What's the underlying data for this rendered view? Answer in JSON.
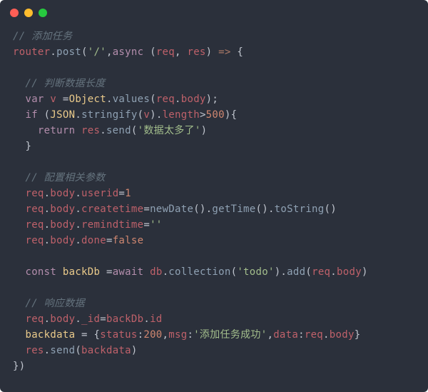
{
  "titlebar": {
    "dots": [
      "red",
      "yellow",
      "green"
    ]
  },
  "code": {
    "c_add_task": "// 添加任务",
    "router": "router",
    "dot1": ".",
    "post": "post",
    "lp": "(",
    "path_str": "'/'",
    "comma1": ",",
    "async_kw": "async",
    "sp": " ",
    "lp2": "(",
    "req": "req",
    "comma2": ", ",
    "res": "res",
    "rp2": ")",
    "arrow": " => ",
    "lb1": "{",
    "c_len": "// 判断数据长度",
    "var_kw": "var",
    "v_id": "v",
    "eq": " =",
    "Object_ty": "Object",
    "values_fn": "values",
    "req2": "req",
    "body": "body",
    "rp3": ");",
    "if_kw": "if",
    "lpif": " (",
    "JSON_ty": "JSON",
    "stringify_fn": "stringify",
    "v_id2": "v",
    "rp_par": ")",
    "length": "length",
    "gt500": ">500){",
    "n500": "500",
    "gt": ">",
    "rp_brace": "){",
    "return_kw": "return",
    "res2": "res",
    "send_fn": "send",
    "too_many_str": "'数据太多了'",
    "rp_send": ")",
    "rb_if": "}",
    "c_cfg": "// 配置相关参数",
    "userid": "userid",
    "eq_plain": "=",
    "n1": "1",
    "createtime": "createtime",
    "newDate_fn": "newDate",
    "getTime_fn": "getTime",
    "toString_fn": "toString",
    "empty2": "()",
    "remindtime": "remindtime",
    "empty_str": "''",
    "done": "done",
    "false_kw": "false",
    "const_kw": "const",
    "backDb": "backDb",
    "await_kw": "await",
    "db": "db",
    "collection_fn": "collection",
    "todo_str": "'todo'",
    "add_fn": "add",
    "c_resp": "// 响应数据",
    "_id": "_id",
    "id_prop": "id",
    "backdata": "backdata",
    "eq_sp": " = ",
    "lbrace": "{",
    "status": "status",
    "colon": ":",
    "n200": "200",
    "msg": "msg",
    "success_str": "'添加任务成功'",
    "data": "data",
    "rbrace": "}",
    "end_paren": "})"
  }
}
